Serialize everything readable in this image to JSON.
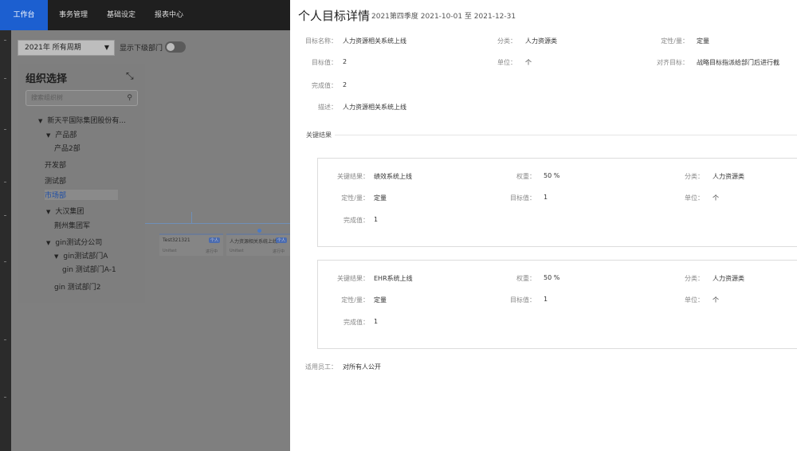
{
  "nav": {
    "tabs": [
      "工作台",
      "事务管理",
      "基础设定",
      "报表中心"
    ],
    "active": 0
  },
  "toolbar": {
    "period_select": "2021年 所有周期",
    "show_sub_label": "显示下级部门"
  },
  "org_panel": {
    "title": "组织选择",
    "search_placeholder": "搜索组织树",
    "tree": [
      {
        "label": "新天平国际集团股份有...",
        "arrow": true
      },
      {
        "label": "产品部",
        "arrow": true
      },
      {
        "label": "产品2部",
        "arrow": false
      },
      {
        "label": "开发部",
        "arrow": false
      },
      {
        "label": "测试部",
        "arrow": false
      },
      {
        "label": "市场部",
        "arrow": false,
        "selected": true
      },
      {
        "label": "大汉集团",
        "arrow": true
      },
      {
        "label": "荆州集团军",
        "arrow": false
      },
      {
        "label": "gin测试分公司",
        "arrow": true
      },
      {
        "label": "gin测试部门A",
        "arrow": true
      },
      {
        "label": "gin 测试部门A-1",
        "arrow": false
      },
      {
        "label": "gin 测试部门2",
        "arrow": false
      }
    ]
  },
  "bg_chart": {
    "nodes": [
      {
        "title": "Test321321",
        "badge": "个人",
        "owner": "Unifast",
        "status": "进行中"
      },
      {
        "title": "人力资源相关系统上线",
        "badge": "个人",
        "owner": "Unifast",
        "status": "进行中"
      }
    ]
  },
  "detail": {
    "title": "个人目标详情",
    "subtitle": "2021第四季度 2021-10-01 至 2021-12-31",
    "fields": {
      "name_label": "目标名称：",
      "name_value": "人力资源相关系统上线",
      "category_label": "分类：",
      "category_value": "人力资源类",
      "type_label": "定性/量：",
      "type_value": "定量",
      "target_label": "目标值：",
      "target_value": "2",
      "unit_label": "单位：",
      "unit_value": "个",
      "align_label": "对齐目标：",
      "align_value": "战略目标指派给部门后进行截",
      "done_label": "完成值：",
      "done_value": "2",
      "desc_label": "描述：",
      "desc_value": "人力资源相关系统上线"
    },
    "key_results_title": "关键结果",
    "key_results": [
      {
        "kr_label": "关键结果：",
        "kr_value": "绩效系统上线",
        "weight_label": "权重：",
        "weight_value": "50 %",
        "category_label": "分类：",
        "category_value": "人力资源类",
        "type_label": "定性/量：",
        "type_value": "定量",
        "target_label": "目标值：",
        "target_value": "1",
        "unit_label": "单位：",
        "unit_value": "个",
        "done_label": "完成值：",
        "done_value": "1"
      },
      {
        "kr_label": "关键结果：",
        "kr_value": "EHR系统上线",
        "weight_label": "权重：",
        "weight_value": "50 %",
        "category_label": "分类：",
        "category_value": "人力资源类",
        "type_label": "定性/量：",
        "type_value": "定量",
        "target_label": "目标值：",
        "target_value": "1",
        "unit_label": "单位：",
        "unit_value": "个",
        "done_label": "完成值：",
        "done_value": "1"
      }
    ],
    "staff_label": "适用员工：",
    "staff_value": "对所有人公开"
  }
}
